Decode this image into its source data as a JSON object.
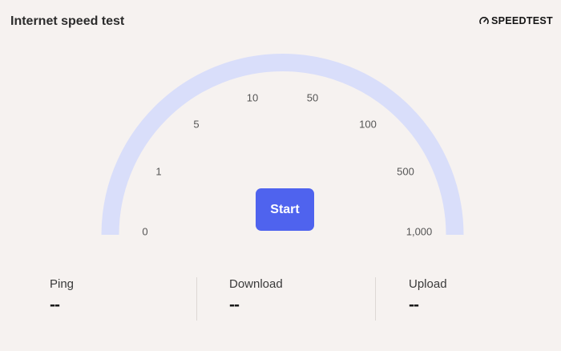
{
  "header": {
    "title": "Internet speed test",
    "brand": "SPEEDTEST"
  },
  "gauge": {
    "ticks": [
      "0",
      "1",
      "5",
      "10",
      "50",
      "100",
      "500",
      "1,000"
    ],
    "track_color": "#d9defa"
  },
  "start_button": {
    "label": "Start",
    "color": "#4f63ee"
  },
  "metrics": [
    {
      "label": "Ping",
      "value": "--"
    },
    {
      "label": "Download",
      "value": "--"
    },
    {
      "label": "Upload",
      "value": "--"
    }
  ]
}
